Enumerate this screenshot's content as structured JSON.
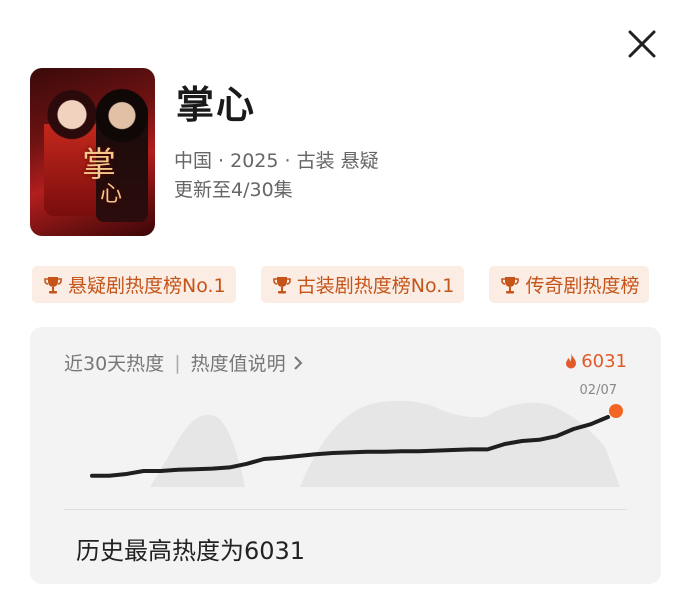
{
  "close_icon": "close-icon",
  "show": {
    "title": "掌心",
    "poster_text": "掌心",
    "meta": "中国 · 2025 · 古装 悬疑",
    "update": "更新至4/30集"
  },
  "tags": [
    {
      "label": "悬疑剧热度榜No.1",
      "icon": "trophy-icon"
    },
    {
      "label": "古装剧热度榜No.1",
      "icon": "trophy-icon"
    },
    {
      "label": "传奇剧热度榜",
      "icon": "trophy-icon"
    }
  ],
  "card": {
    "heading": "近30天热度",
    "separator": "|",
    "explain": "热度值说明",
    "heat_value": "6031",
    "latest_date": "02/07",
    "history": "历史最高热度为6031"
  },
  "chart_data": {
    "type": "line",
    "series": [
      {
        "values": [
          0.02,
          0.02,
          0.05,
          0.1,
          0.1,
          0.12,
          0.13,
          0.14,
          0.16,
          0.22,
          0.3,
          0.32,
          0.35,
          0.38,
          0.4,
          0.41,
          0.42,
          0.42,
          0.43,
          0.43,
          0.44,
          0.45,
          0.46,
          0.46,
          0.55,
          0.6,
          0.62,
          0.68,
          0.8,
          0.88,
          1.0
        ]
      }
    ],
    "latest": {
      "x": "02/07",
      "y": 6031
    },
    "colors": {
      "line": "#1f1f1f",
      "marker": "#f26522",
      "background_area": "#e8e8e8"
    }
  }
}
